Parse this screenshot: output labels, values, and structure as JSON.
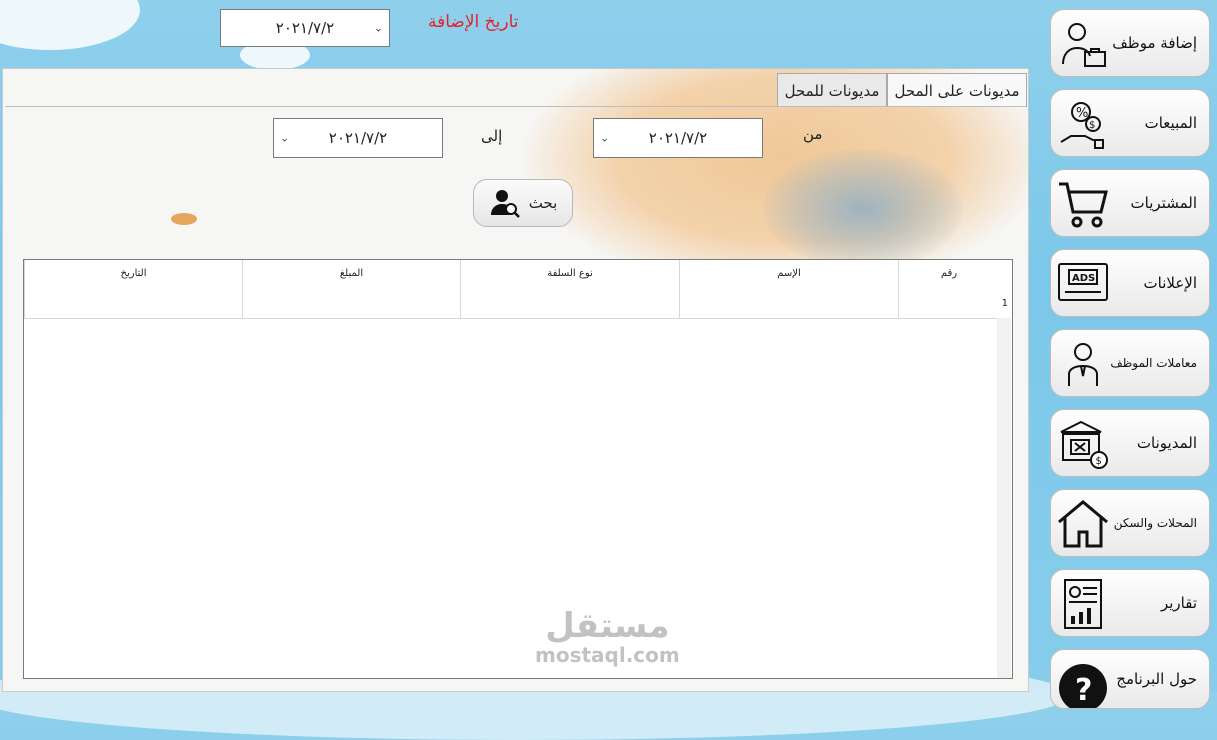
{
  "top": {
    "date_value": "٢٠٢١/٧/٢",
    "date_label": "تاريخ الإضافة"
  },
  "tabs": [
    {
      "label": "مديونات على المحل"
    },
    {
      "label": "مديونات للمحل"
    }
  ],
  "filter": {
    "from_label": "من",
    "from_value": "٢٠٢١/٧/٢",
    "to_label": "إلى",
    "to_value": "٢٠٢١/٧/٢",
    "search_label": "بحث"
  },
  "grid": {
    "columns": [
      "رقم",
      "الإسم",
      "نوع السلفة",
      "المبلغ",
      "التاريخ"
    ],
    "row_number": "1"
  },
  "sidebar": [
    {
      "label": "إضافة موظف",
      "icon": "employee-briefcase-icon"
    },
    {
      "label": "المبيعات",
      "icon": "sales-hand-money-icon"
    },
    {
      "label": "المشتريات",
      "icon": "shopping-cart-icon"
    },
    {
      "label": "الإعلانات",
      "icon": "ads-screen-icon"
    },
    {
      "label": "معاملات الموظف",
      "icon": "employee-icon"
    },
    {
      "label": "المديونات",
      "icon": "bank-money-bag-icon"
    },
    {
      "label": "المحلات والسكن",
      "icon": "house-icon"
    },
    {
      "label": "تقارير",
      "icon": "report-chart-icon"
    },
    {
      "label": "حول البرنامج",
      "icon": "question-icon"
    }
  ],
  "watermark": {
    "arabic": "مستقل",
    "latin": "mostaql.com"
  },
  "colors": {
    "label_red": "#e0262b",
    "sky": "#86cdec"
  }
}
